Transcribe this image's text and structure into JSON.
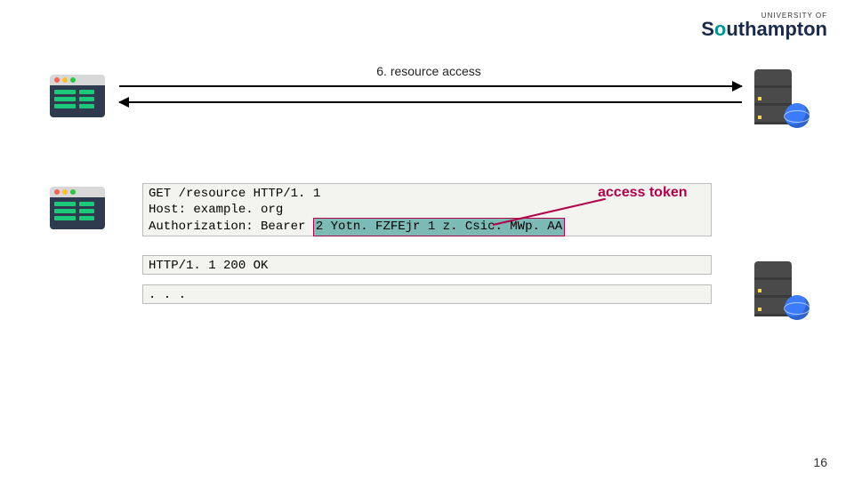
{
  "logo": {
    "sup": "UNIVERSITY OF",
    "main_pre": "S",
    "main_highlight": "o",
    "main_post": "uthampton"
  },
  "step": {
    "label": "6. resource access"
  },
  "request": {
    "line1": "GET /resource HTTP/1. 1",
    "line2": "Host: example. org",
    "auth_prefix": "Authorization: Bearer ",
    "token": "2 Yotn. FZFEjr 1 z. Csic. MWp. AA"
  },
  "response": {
    "status": "HTTP/1. 1 200 OK",
    "body": ". . ."
  },
  "annotation": "access token",
  "page_number": "16"
}
